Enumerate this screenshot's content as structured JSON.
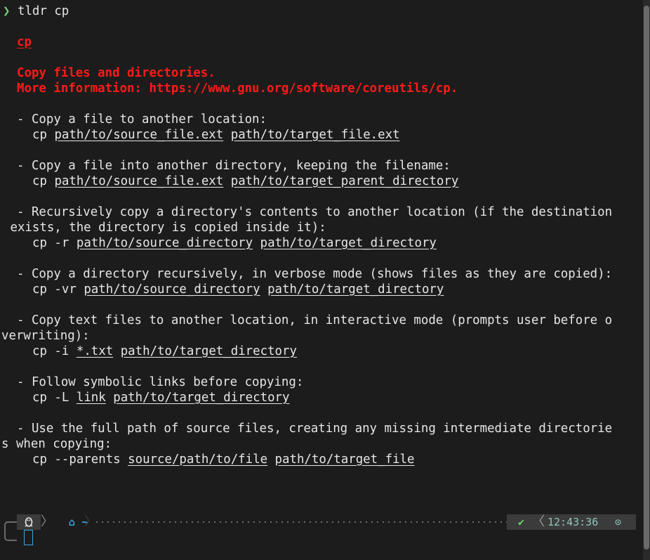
{
  "prompt": {
    "symbol": "❯",
    "command": "tldr cp"
  },
  "page": {
    "title": "cp",
    "description": "Copy files and directories.",
    "more_info": "More information: https://www.gnu.org/software/coreutils/cp."
  },
  "examples": [
    {
      "desc": "- Copy a file to another location:",
      "cmd": "cp",
      "args": [
        "path/to/source_file.ext",
        "path/to/target_file.ext"
      ]
    },
    {
      "desc": "- Copy a file into another directory, keeping the filename:",
      "cmd": "cp",
      "args": [
        "path/to/source_file.ext",
        "path/to/target_parent_directory"
      ]
    },
    {
      "desc": "- Recursively copy a directory's contents to another location (if the destination",
      "desc_cont": " exists, the directory is copied inside it):",
      "cmd": "cp -r",
      "args": [
        "path/to/source_directory",
        "path/to/target_directory"
      ]
    },
    {
      "desc": "- Copy a directory recursively, in verbose mode (shows files as they are copied):",
      "cmd": "cp -vr",
      "args": [
        "path/to/source_directory",
        "path/to/target_directory"
      ]
    },
    {
      "desc": "- Copy text files to another location, in interactive mode (prompts user before o",
      "desc_cont": "verwriting):",
      "cmd": "cp -i",
      "args": [
        "*.txt",
        "path/to/target_directory"
      ]
    },
    {
      "desc": "- Follow symbolic links before copying:",
      "cmd": "cp -L",
      "args": [
        "link",
        "path/to/target_directory"
      ]
    },
    {
      "desc": "- Use the full path of source files, creating any missing intermediate directorie",
      "desc_cont": "s when copying:",
      "cmd": "cp --parents",
      "args": [
        "source/path/to/file",
        "path/to/target_file"
      ]
    }
  ],
  "statusbar": {
    "os_icon": "linux-penguin-icon",
    "home_icon": "home-icon",
    "cwd": "~",
    "status_ok": "✔",
    "time": "12:43:36",
    "clock_icon": "clock-icon"
  },
  "colors": {
    "accent_red": "#ff1a1a",
    "prompt_green": "#6bd36b",
    "path_blue": "#39a9e0",
    "time_teal": "#8fc7bd"
  }
}
